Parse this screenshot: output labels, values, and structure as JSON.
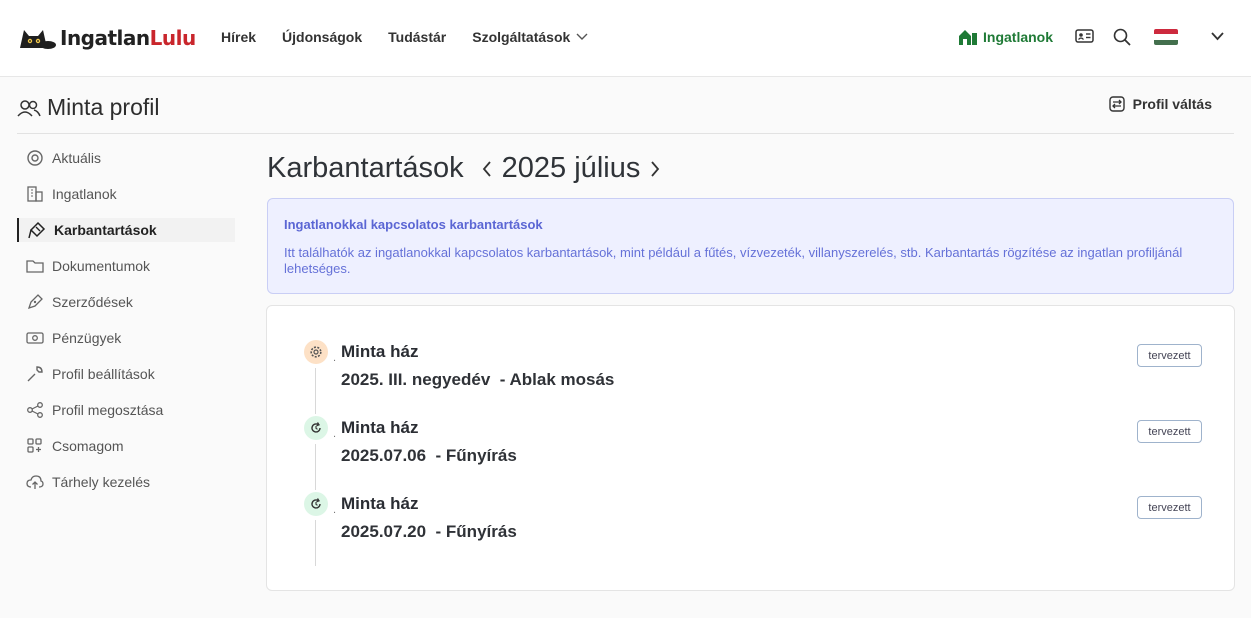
{
  "header": {
    "logo": {
      "part1": "Ingatlan",
      "part2": "Lulu"
    },
    "nav": [
      "Hírek",
      "Újdonságok",
      "Tudástár",
      "Szolgáltatások"
    ],
    "ingatlanok_link": "Ingatlanok",
    "language": "hu"
  },
  "profile": {
    "title": "Minta profil",
    "switch_label": "Profil váltás"
  },
  "sidebar": {
    "items": [
      {
        "label": "Aktuális",
        "icon": "target-icon"
      },
      {
        "label": "Ingatlanok",
        "icon": "building-icon"
      },
      {
        "label": "Karbantartások",
        "icon": "brush-icon",
        "active": true
      },
      {
        "label": "Dokumentumok",
        "icon": "folder-icon"
      },
      {
        "label": "Szerződések",
        "icon": "pen-icon"
      },
      {
        "label": "Pénzügyek",
        "icon": "money-icon"
      },
      {
        "label": "Profil beállítások",
        "icon": "wrench-icon"
      },
      {
        "label": "Profil megosztása",
        "icon": "share-icon"
      },
      {
        "label": "Csomagom",
        "icon": "apps-icon"
      },
      {
        "label": "Tárhely kezelés",
        "icon": "cloud-upload-icon"
      }
    ]
  },
  "main": {
    "title": "Karbantartások",
    "period": "2025 július",
    "info": {
      "title": "Ingatlanokkal kapcsolatos karbantartások",
      "text": "Itt találhatók az ingatlanokkal kapcsolatos karbantartások, mint például a fűtés, vízvezeték, villanyszerelés, stb. Karbantartás rögzítése az ingatlan profiljánál lehetséges."
    },
    "entries": [
      {
        "property": "Minta ház",
        "detail": "2025. III. negyedév  - Ablak mosás",
        "status": "tervezett",
        "icon": "gear-icon"
      },
      {
        "property": "Minta ház",
        "detail": "2025.07.06  - Fűnyírás",
        "status": "tervezett",
        "icon": "refresh-icon"
      },
      {
        "property": "Minta ház",
        "detail": "2025.07.20  - Fűnyírás",
        "status": "tervezett",
        "icon": "refresh-icon"
      }
    ]
  },
  "colors": {
    "brand_red": "#c9262c",
    "brand_green": "#1f7a36",
    "info_blue": "#5b66d4"
  }
}
